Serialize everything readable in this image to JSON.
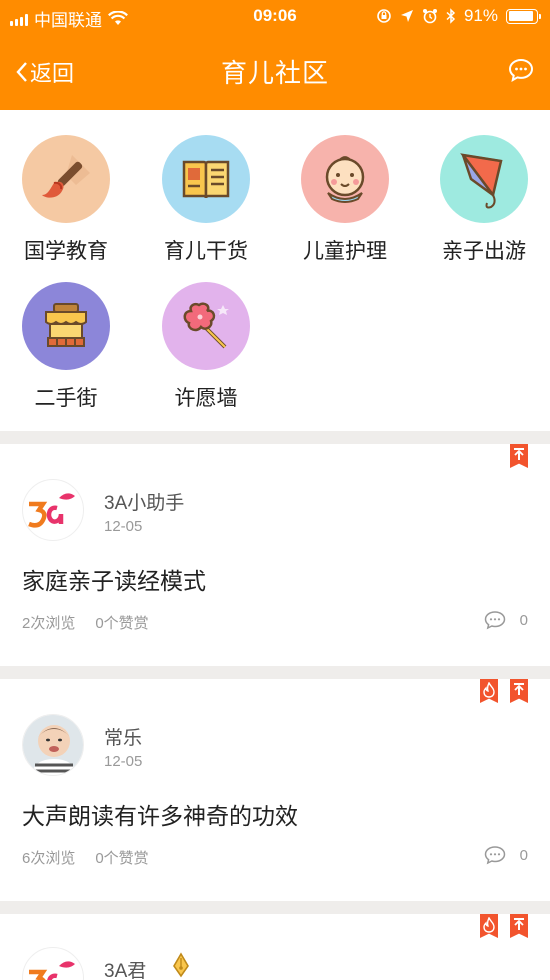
{
  "status_bar": {
    "carrier": "中国联通",
    "time": "09:06",
    "battery": "91%",
    "battery_level": 0.91
  },
  "nav": {
    "back_label": "返回",
    "title": "育儿社区"
  },
  "categories": [
    {
      "label": "国学教育",
      "icon": "brush-icon",
      "color": "#f5c9a3"
    },
    {
      "label": "育儿干货",
      "icon": "book-icon",
      "color": "#a7dcf2"
    },
    {
      "label": "儿童护理",
      "icon": "baby-icon",
      "color": "#f7b3ac"
    },
    {
      "label": "亲子出游",
      "icon": "kite-icon",
      "color": "#9eeae0"
    },
    {
      "label": "二手街",
      "icon": "shop-icon",
      "color": "#8c86d9"
    },
    {
      "label": "许愿墙",
      "icon": "candy-icon",
      "color": "#e2b3ec"
    }
  ],
  "posts": [
    {
      "author": "3A小助手",
      "date": "12-05",
      "title": "家庭亲子读经模式",
      "views": "2次浏览",
      "likes": "0个赞赏",
      "comments": "0"
    },
    {
      "author": "常乐",
      "date": "12-05",
      "title": "大声朗读有许多神奇的功效",
      "views": "6次浏览",
      "likes": "0个赞赏",
      "comments": "0"
    },
    {
      "author": "3A君",
      "date": "",
      "title": "",
      "views": "",
      "likes": "",
      "comments": ""
    }
  ],
  "colors": {
    "brand_orange": "#ff8c00",
    "badge_red": "#f2542d",
    "divider": "#efedeb"
  }
}
